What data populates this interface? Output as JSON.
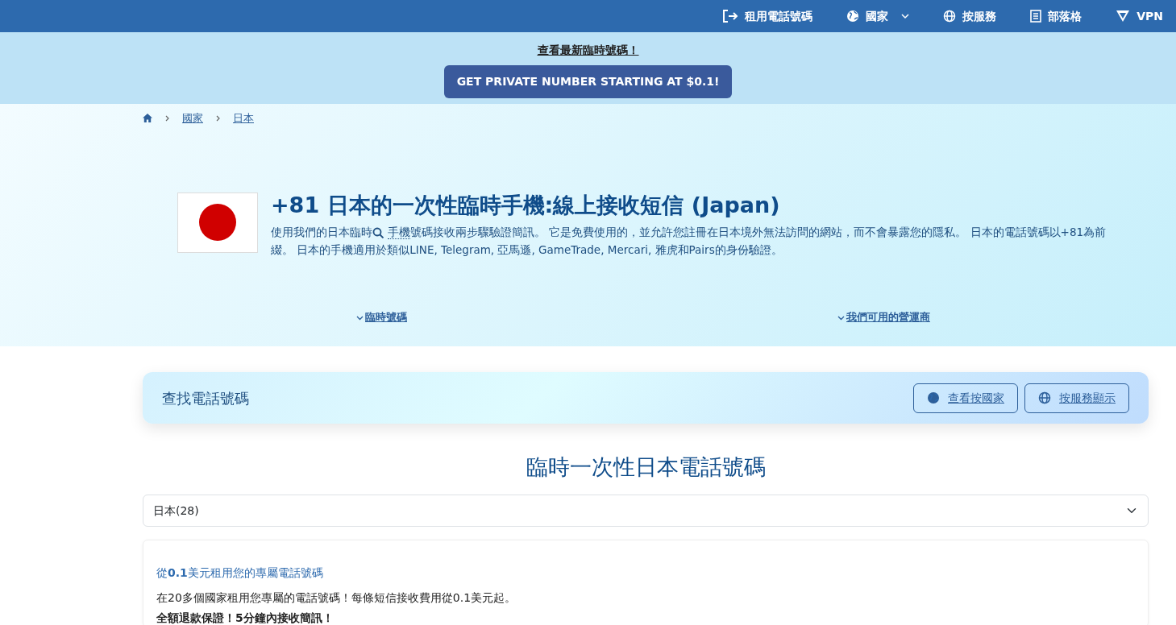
{
  "nav": [
    {
      "kind": "login",
      "label": "租用電話號碼",
      "dropdown": false
    },
    {
      "kind": "globe",
      "label": "國家",
      "dropdown": true
    },
    {
      "kind": "grid",
      "label": "按服務",
      "dropdown": false
    },
    {
      "kind": "doc",
      "label": "部落格",
      "dropdown": false
    },
    {
      "kind": "vpn",
      "label": "VPN",
      "dropdown": false
    }
  ],
  "banner": {
    "link": "查看最新臨時號碼！",
    "button": "GET PRIVATE NUMBER STARTING AT $0.1!"
  },
  "breadcrumb": [
    "國家",
    "日本"
  ],
  "hero": {
    "title": "+81 日本的一次性臨時手機:線上接收短信 (Japan)",
    "description_before": "使用我們的日本臨時",
    "term": "手機",
    "description_after": "號碼接收兩步驟驗證簡訊。 它是免費使用的，並允許您註冊在日本境外無法訪問的網站，而不會暴露您的隱私。 日本的電話號碼以+81為前綴。 日本的手機適用於類似LINE, Telegram, 亞馬遜, GameTrade, Mercari, 雅虎和Pairs的身份驗證。"
  },
  "anchors": [
    "臨時號碼",
    "我們可用的營運商"
  ],
  "finder": {
    "title": "查找電話號碼",
    "buttons": [
      {
        "kind": "globe",
        "label": "查看按國家"
      },
      {
        "kind": "grid",
        "label": "按服務顯示"
      }
    ]
  },
  "section_title": "臨時一次性日本電話號碼",
  "select": {
    "value": "日本(28)"
  },
  "promo": {
    "title": "從**0.1**美元租用您的專屬電話號碼",
    "text": "在20多個國家租用您專屬的電話號碼！每條短信接收費用從0.1美元起。",
    "bold_line": "全額退款保證！5分鐘內接收簡訊！"
  }
}
